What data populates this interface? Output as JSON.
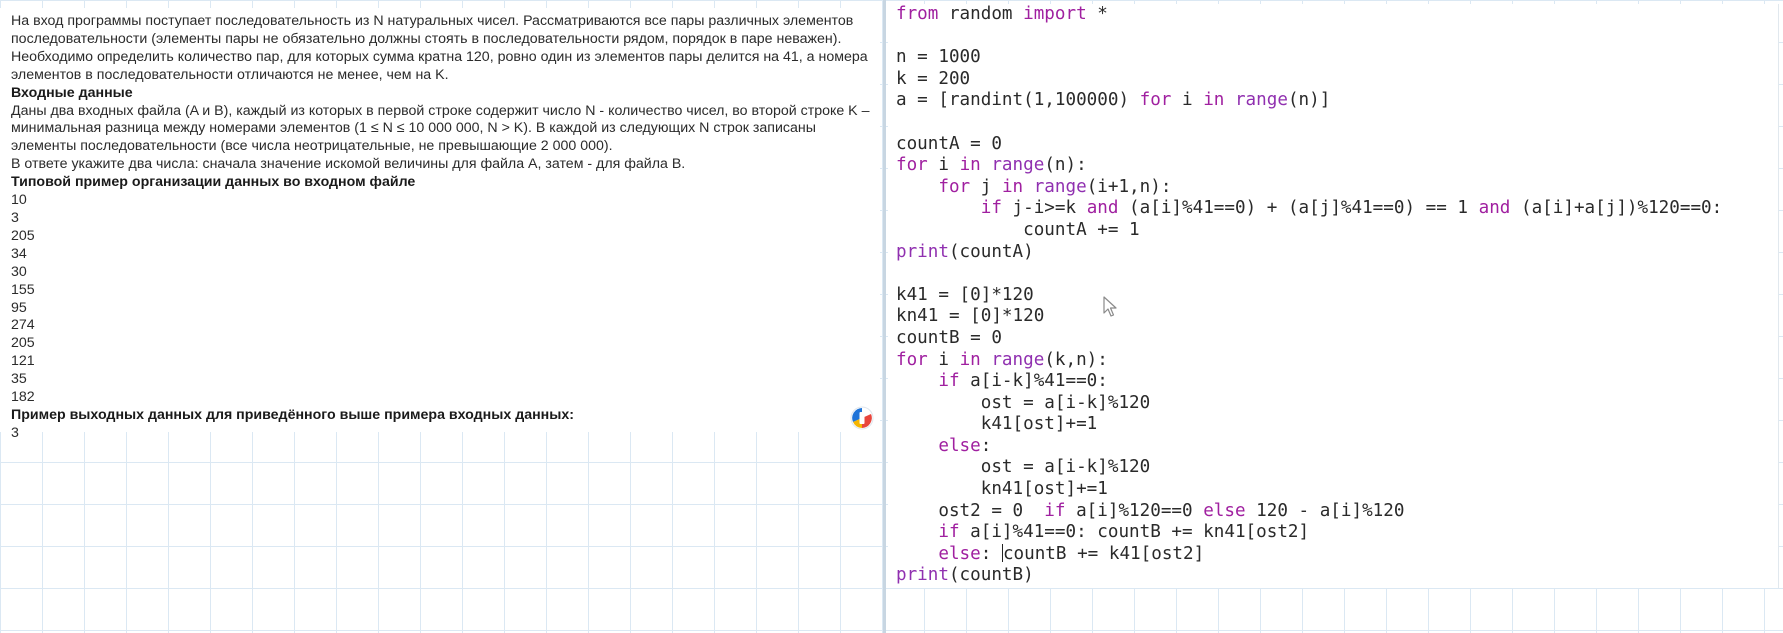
{
  "task": {
    "paragraphs": [
      "На вход программы поступает последовательность из N натуральных чисел. Рассматриваются все пары различных элементов последовательности (элементы пары не обязательно должны стоять в последовательности рядом, порядок в паре неважен). Необходимо определить количество пар, для которых сумма кратна 120, ровно один из элементов пары делится на 41, а номера элементов в последовательности отличаются не менее, чем на K."
    ],
    "input_heading": "Входные данные",
    "input_text": "Даны два входных файла (A и B), каждый из которых в первой строке содержит число N - количество чисел, во второй строке K – минимальная разница между номерами элементов (1 ≤ N ≤ 10 000 000, N > K). В каждой из следующих N строк записаны элементы последовательности (все числа неотрицательные, не превышающие 2 000 000).",
    "answer_text": "В ответе укажите два числа: сначала значение искомой величины для файла A, затем - для файла B.",
    "example_heading": "Типовой пример организации данных во входном файле",
    "example_input": [
      "10",
      "3",
      "205",
      "34",
      "30",
      "155",
      "95",
      "274",
      "205",
      "121",
      "35",
      "182"
    ],
    "output_heading": "Пример выходных данных для приведённого выше примера входных данных:",
    "example_output": "3"
  },
  "code": {
    "lines": [
      [
        {
          "t": "from",
          "c": "kw"
        },
        {
          "t": " random "
        },
        {
          "t": "import",
          "c": "kw"
        },
        {
          "t": " *"
        }
      ],
      [],
      [
        {
          "t": "n = 1000"
        }
      ],
      [
        {
          "t": "k = 200"
        }
      ],
      [
        {
          "t": "a = [randint(1,100000) "
        },
        {
          "t": "for",
          "c": "kw"
        },
        {
          "t": " i "
        },
        {
          "t": "in",
          "c": "kw"
        },
        {
          "t": " "
        },
        {
          "t": "range",
          "c": "bl"
        },
        {
          "t": "(n)]"
        }
      ],
      [],
      [
        {
          "t": "countA = 0"
        }
      ],
      [
        {
          "t": "for",
          "c": "kw"
        },
        {
          "t": " i "
        },
        {
          "t": "in",
          "c": "kw"
        },
        {
          "t": " "
        },
        {
          "t": "range",
          "c": "bl"
        },
        {
          "t": "(n):"
        }
      ],
      [
        {
          "t": "    "
        },
        {
          "t": "for",
          "c": "kw"
        },
        {
          "t": " j "
        },
        {
          "t": "in",
          "c": "kw"
        },
        {
          "t": " "
        },
        {
          "t": "range",
          "c": "bl"
        },
        {
          "t": "(i+1,n):"
        }
      ],
      [
        {
          "t": "        "
        },
        {
          "t": "if",
          "c": "kw"
        },
        {
          "t": " j-i>=k "
        },
        {
          "t": "and",
          "c": "kw"
        },
        {
          "t": " (a[i]%41==0) + (a[j]%41==0) == 1 "
        },
        {
          "t": "and",
          "c": "kw"
        },
        {
          "t": " (a[i]+a[j])%120==0:"
        }
      ],
      [
        {
          "t": "            countA += 1"
        }
      ],
      [
        {
          "t": "print",
          "c": "bl"
        },
        {
          "t": "(countA)"
        }
      ],
      [],
      [
        {
          "t": "k41 = [0]*120"
        }
      ],
      [
        {
          "t": "kn41 = [0]*120"
        }
      ],
      [
        {
          "t": "countB = 0"
        }
      ],
      [
        {
          "t": "for",
          "c": "kw"
        },
        {
          "t": " i "
        },
        {
          "t": "in",
          "c": "kw"
        },
        {
          "t": " "
        },
        {
          "t": "range",
          "c": "bl"
        },
        {
          "t": "(k,n):"
        }
      ],
      [
        {
          "t": "    "
        },
        {
          "t": "if",
          "c": "kw"
        },
        {
          "t": " a[i-k]%41==0:"
        }
      ],
      [
        {
          "t": "        ost = a[i-k]%120"
        }
      ],
      [
        {
          "t": "        k41[ost]+=1"
        }
      ],
      [
        {
          "t": "    "
        },
        {
          "t": "else",
          "c": "kw"
        },
        {
          "t": ":"
        }
      ],
      [
        {
          "t": "        ost = a[i-k]%120"
        }
      ],
      [
        {
          "t": "        kn41[ost]+=1"
        }
      ],
      [
        {
          "t": "    ost2 = 0  "
        },
        {
          "t": "if",
          "c": "kw"
        },
        {
          "t": " a[i]%120==0 "
        },
        {
          "t": "else",
          "c": "kw"
        },
        {
          "t": " 120 - a[i]%120"
        }
      ],
      [
        {
          "t": "    "
        },
        {
          "t": "if",
          "c": "kw"
        },
        {
          "t": " a[i]%41==0: countB += kn41[ost2]"
        }
      ],
      [
        {
          "t": "    "
        },
        {
          "t": "else",
          "c": "kw"
        },
        {
          "t": ": "
        },
        {
          "t": "",
          "c": "caret"
        },
        {
          "t": "countB += k41[ost2]"
        }
      ],
      [
        {
          "t": "print",
          "c": "bl"
        },
        {
          "t": "(countB)"
        }
      ]
    ]
  },
  "colors": {
    "keyword": "#a020a0",
    "builtin": "#9030b0",
    "grid": "#dbe8f3"
  },
  "icons": {
    "pointer": "mouse-pointer-icon",
    "badge": "app-badge-icon"
  }
}
